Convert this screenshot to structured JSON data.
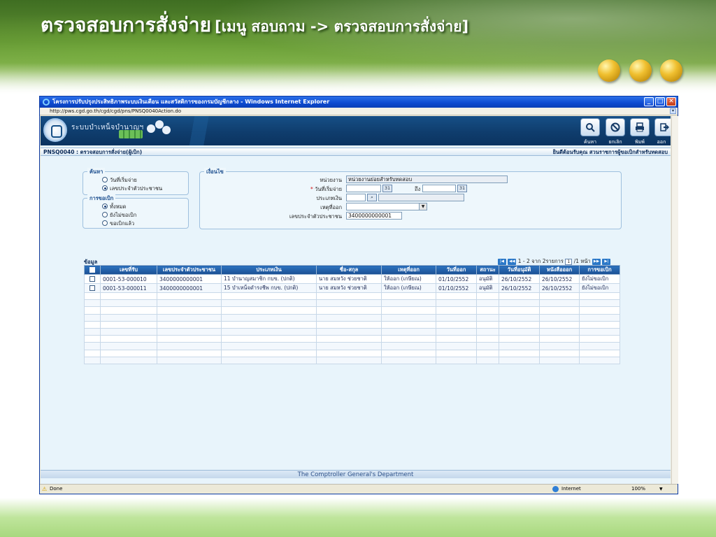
{
  "slide": {
    "title_big": "ตรวจสอบการสั่งจ่าย",
    "title_small": "[เมนู สอบถาม -> ตรวจสอบการสั่งจ่าย]"
  },
  "window": {
    "title": "โครงการปรับปรุงประสิทธิภาพระบบเงินเดือน และสวัสดิการของกรมบัญชีกลาง - Windows Internet Explorer",
    "address": "http://pws.cgd.go.th/cgd/cgd/pns/PNSQ0040Action.do",
    "status_done": "Done",
    "status_zone": "Internet",
    "status_zoom": "100%"
  },
  "app": {
    "name": "ระบบบำเหน็จบำนาญฯ",
    "toolbar": {
      "search_label": "ค้นหา",
      "cancel_label": "ยกเลิก",
      "print_label": "พิมพ์",
      "exit_label": "ออก"
    },
    "page_code_title": "PNSQ0040 : ตรวจสอบการสั่งจ่าย(ผู้เบิก)",
    "welcome": "ยินดีต้อนรับคุณ สวนราชการผู้ขอเบิกสำหรับทดสอบ",
    "footer": "The Comptroller General's Department"
  },
  "search_box": {
    "legend": "ค้นหา",
    "options": [
      "วันที่เริ่มจ่าย",
      "เลขประจำตัวประชาชน"
    ],
    "selected": "เลขประจำตัวประชาชน"
  },
  "request_box": {
    "legend": "การขอเบิก",
    "options": [
      "ทั้งหมด",
      "ยังไม่ขอเบิก",
      "ขอเบิกแล้ว"
    ],
    "selected": "ทั้งหมด"
  },
  "conditions": {
    "legend": "เงื่อนไข",
    "unit_label": "หน่วยงาน",
    "unit_value": "หน่วยงานย่อยสำหรับทดสอบ",
    "start_date_label": "วันที่เริ่มจ่าย",
    "start_date_required": "*",
    "to_label": "ถึง",
    "calendar_icon": "31",
    "money_type_label": "ประเภทเงิน",
    "money_type_value": "",
    "reason_label": "เหตุที่ออก",
    "reason_value": "",
    "citizen_id_label": "เลขประจำตัวประชาชน",
    "citizen_id_value": "3400000000001"
  },
  "grid": {
    "caption": "ข้อมูล",
    "pager_text": "1 - 2 จาก 2รายการ",
    "pager_page": "1",
    "pager_total": "/1 หน้า",
    "columns": [
      "เลขที่รับ",
      "เลขประจำตัวประชาชน",
      "ประเภทเงิน",
      "ชื่อ-สกุล",
      "เหตุที่ออก",
      "วันที่ออก",
      "สถานะ",
      "วันที่อนุมัติ",
      "หนังสือออก",
      "การขอเบิก"
    ],
    "rows": [
      [
        "0001-53-000010",
        "3400000000001",
        "11 บำนาญสมาชิก กบข. (ปกติ)",
        "นาย สมหวัง ช่วยชาติ",
        "ให้ออก (เกษียณ)",
        "01/10/2552",
        "อนุมัติ",
        "26/10/2552",
        "26/10/2552",
        "ยังไม่ขอเบิก"
      ],
      [
        "0001-53-000011",
        "3400000000001",
        "15 บำเหน็จดำรงชีพ กบข. (ปกติ)",
        "นาย สมหวัง ช่วยชาติ",
        "ให้ออก (เกษียณ)",
        "01/10/2552",
        "อนุมัติ",
        "26/10/2552",
        "26/10/2552",
        "ยังไม่ขอเบิก"
      ]
    ]
  },
  "colors": {
    "banner": "#164f86",
    "grid_header": "#2d73c0",
    "page_bg": "#e8f4fb"
  }
}
